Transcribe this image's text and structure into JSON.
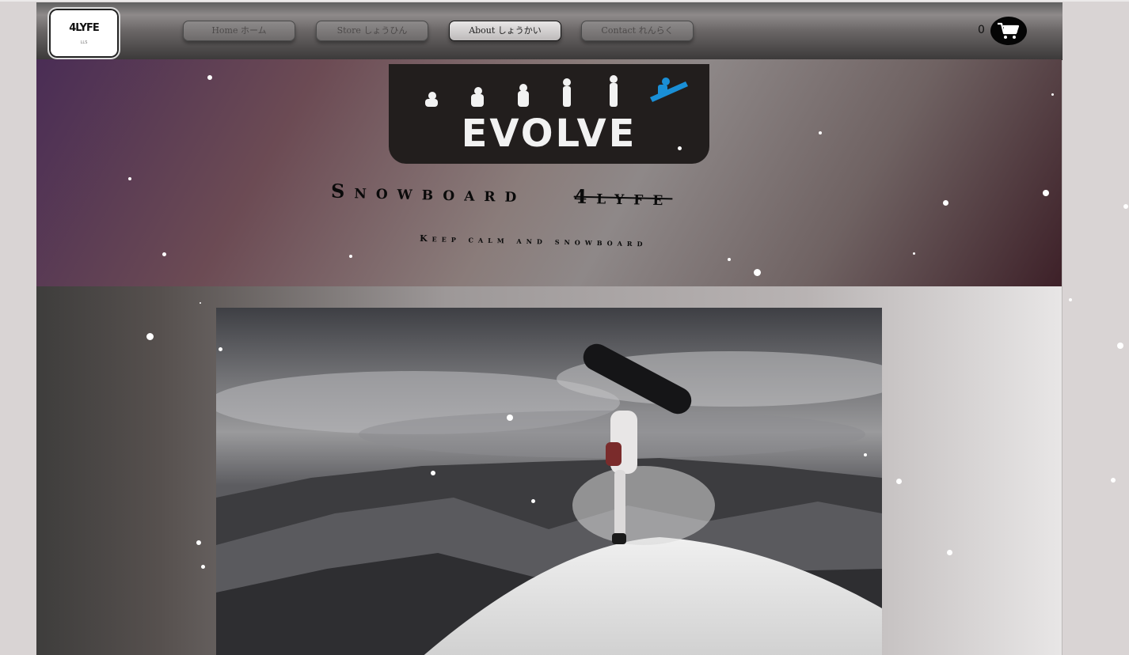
{
  "header": {
    "logo_text": "4LYFE",
    "logo_subtext": "LLS",
    "nav": [
      {
        "label": "Home ホーム",
        "active": false
      },
      {
        "label": "Store しょうひん",
        "active": false
      },
      {
        "label": "About しょうかい",
        "active": true
      },
      {
        "label": "Contact れんらく",
        "active": false
      }
    ],
    "cart_count": "0",
    "cart_icon": "shopping-cart-icon"
  },
  "banner": {
    "logo_word": "EVOLVE",
    "logo_icon": "evolution-snowboarder-icon",
    "title_main": "Snowboard",
    "title_brand": "4lyfe",
    "tagline": "Keep calm and snowboard"
  },
  "content": {
    "photo_subject": "snowboarder-handplant-photo"
  },
  "colors": {
    "accent_blue": "#1a8fd6",
    "navbar_dark": "#3c3a3a",
    "banner_purple": "#4a2d55"
  }
}
